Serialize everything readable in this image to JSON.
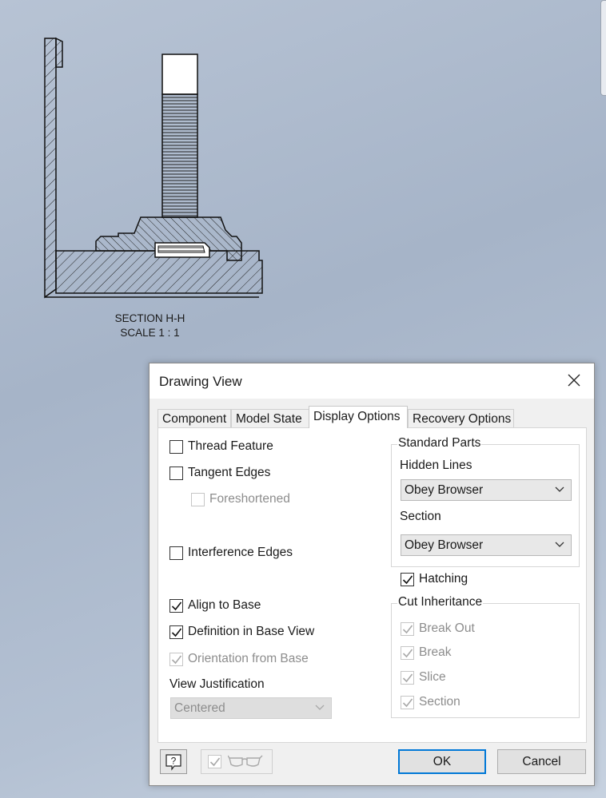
{
  "section_view": {
    "title": "SECTION H-H",
    "scale": "SCALE 1 : 1"
  },
  "dialog": {
    "title": "Drawing View",
    "tabs": [
      {
        "label": "Component",
        "active": false
      },
      {
        "label": "Model State",
        "active": false
      },
      {
        "label": "Display Options",
        "active": true
      },
      {
        "label": "Recovery Options",
        "active": false
      }
    ],
    "left_options": {
      "thread_feature": {
        "label": "Thread Feature",
        "checked": false,
        "enabled": true
      },
      "tangent_edges": {
        "label": "Tangent Edges",
        "checked": false,
        "enabled": true
      },
      "foreshortened": {
        "label": "Foreshortened",
        "checked": false,
        "enabled": false
      },
      "interference_edges": {
        "label": "Interference Edges",
        "checked": false,
        "enabled": true
      },
      "align_to_base": {
        "label": "Align to Base",
        "checked": true,
        "enabled": true
      },
      "definition_in_base_view": {
        "label": "Definition in Base View",
        "checked": true,
        "enabled": true
      },
      "orientation_from_base": {
        "label": "Orientation from Base",
        "checked": true,
        "enabled": false
      },
      "view_justification": {
        "label": "View Justification",
        "value": "Centered",
        "enabled": false
      }
    },
    "standard_parts": {
      "title": "Standard Parts",
      "hidden_lines_label": "Hidden Lines",
      "hidden_lines_value": "Obey Browser",
      "section_label": "Section",
      "section_value": "Obey Browser"
    },
    "hatching": {
      "label": "Hatching",
      "checked": true
    },
    "cut_inheritance": {
      "title": "Cut Inheritance",
      "items": [
        {
          "label": "Break Out",
          "checked": true
        },
        {
          "label": "Break",
          "checked": true
        },
        {
          "label": "Slice",
          "checked": true
        },
        {
          "label": "Section",
          "checked": true
        }
      ]
    },
    "buttons": {
      "ok": "OK",
      "cancel": "Cancel"
    },
    "icons": {
      "help": "help-icon",
      "glasses": "glasses-icon"
    }
  }
}
